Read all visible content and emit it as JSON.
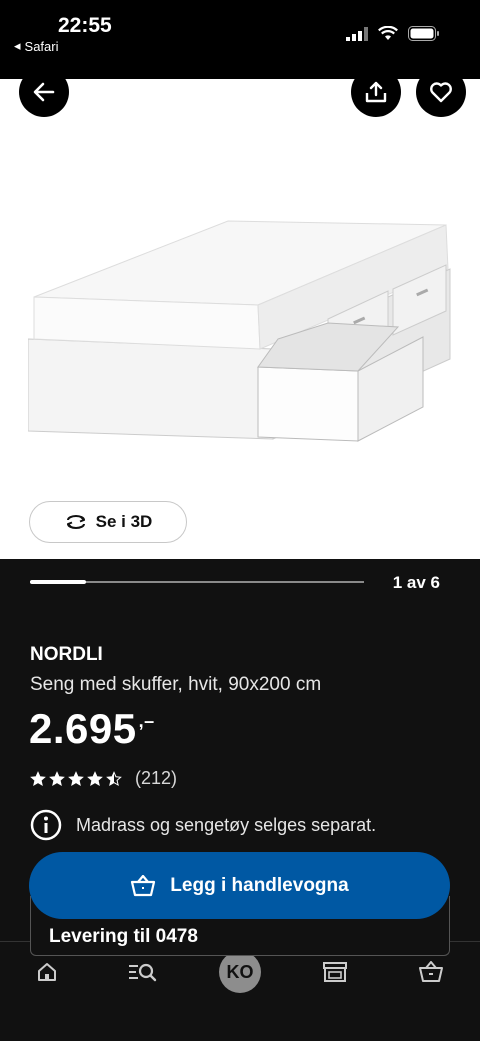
{
  "status_bar": {
    "time": "22:55",
    "back_app": "Safari"
  },
  "media": {
    "view_3d_label": "Se i 3D",
    "page_counter": "1 av 6",
    "progress_fraction": 0.1667
  },
  "product": {
    "name": "NORDLI",
    "description": "Seng med skuffer, hvit, 90x200 cm",
    "price": "2.695",
    "price_suffix": ",–",
    "rating_stars": 4.5,
    "rating_count": "(212)",
    "notice": "Madrass og sengetøy selges separat."
  },
  "actions": {
    "add_to_cart_label": "Legg i handlevogna",
    "delivery_label": "Levering til 0478"
  },
  "bottom_nav": {
    "avatar_initials": "KO",
    "items": [
      "home-icon",
      "search-icon",
      "profile-avatar",
      "store-icon",
      "cart-icon"
    ]
  },
  "colors": {
    "primary_blue": "#0058a3",
    "background_dark": "#111111"
  }
}
